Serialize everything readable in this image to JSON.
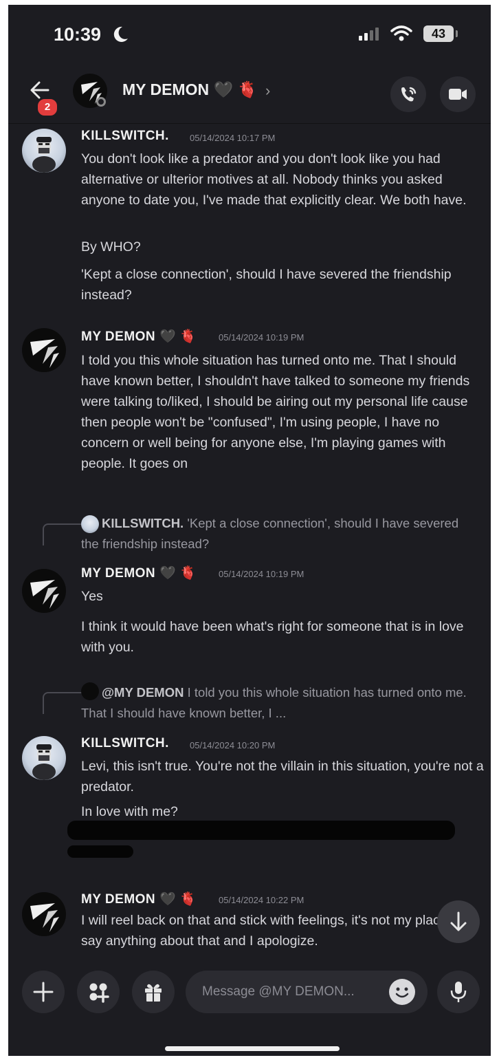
{
  "status_bar": {
    "time": "10:39",
    "battery": "43"
  },
  "header": {
    "title": "MY DEMON",
    "title_emoji": "🖤 🫀",
    "notification_count": "2"
  },
  "messages": [
    {
      "author": "KILLSWITCH.",
      "timestamp": "05/14/2024 10:17 PM",
      "paragraphs": [
        "You don't look like a predator and you don't look like you had alternative or ulterior motives at all. Nobody thinks you asked anyone to date you, I've made that explicitly clear. We both have.",
        "By WHO?",
        "'Kept a close connection', should I have severed the friendship instead?"
      ]
    },
    {
      "author": "MY DEMON",
      "timestamp": "05/14/2024 10:19 PM",
      "paragraphs": [
        "I told you this whole situation has turned onto me. That I should have known better, I shouldn't have talked to someone my friends were talking to/liked, I should be airing out my personal life cause then people won't be \"confused\", I'm using people, I have no concern or well being for anyone else, I'm playing games with people. It goes on"
      ]
    },
    {
      "reply_author": "KILLSWITCH.",
      "reply_text": "'Kept a close connection', should I have severed the friendship instead?",
      "author": "MY DEMON",
      "timestamp": "05/14/2024 10:19 PM",
      "paragraphs": [
        "Yes",
        "I think it would have been what's right for someone that is in love with you."
      ]
    },
    {
      "reply_author": "@MY DEMON",
      "reply_text": "I told you this whole situation has turned onto me. That I should have known better, I ...",
      "author": "KILLSWITCH.",
      "timestamp": "05/14/2024 10:20 PM",
      "paragraphs": [
        "Levi, this isn't true. You're not the villain in this situation, you're not a predator.",
        "In love with me?"
      ]
    },
    {
      "author": "MY DEMON",
      "timestamp": "05/14/2024 10:22 PM",
      "paragraphs": [
        "I will reel back on that and stick with feelings, it's not my place to say anything about that and I apologize."
      ]
    }
  ],
  "composer": {
    "placeholder": "Message @MY DEMON..."
  }
}
